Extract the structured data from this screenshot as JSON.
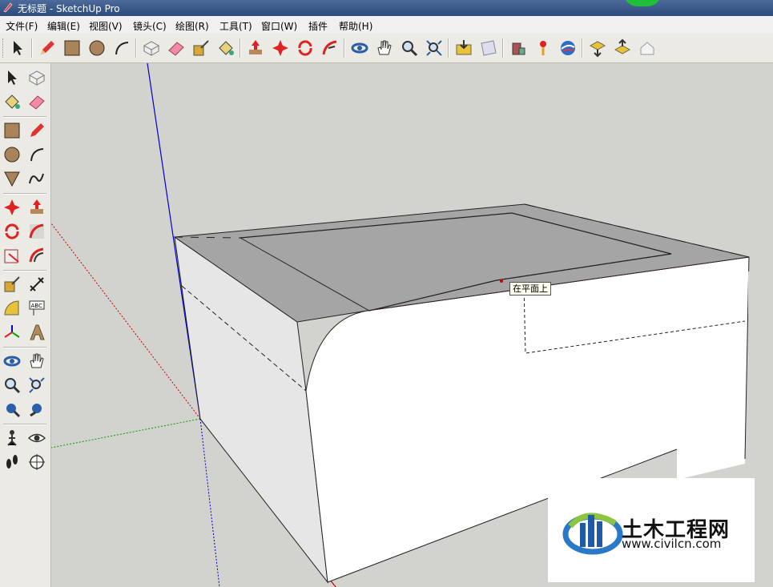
{
  "window": {
    "title": "无标题 - SketchUp Pro"
  },
  "menu": [
    "文件(F)",
    "编辑(E)",
    "视图(V)",
    "镜头(C)",
    "绘图(R)",
    "工具(T)",
    "窗口(W)",
    "插件",
    "帮助(H)"
  ],
  "toolbar_icons": [
    "select-icon",
    "pencil-icon",
    "rectangle-icon",
    "circle-icon",
    "arc-icon",
    "make-component-icon",
    "eraser-icon",
    "tape-measure-icon",
    "paint-bucket-icon",
    "push-pull-icon",
    "move-icon",
    "rotate-icon",
    "follow-me-icon",
    "orbit-icon",
    "pan-icon",
    "zoom-icon",
    "zoom-extents-icon",
    "get-models-icon",
    "share-model-icon",
    "components-icon",
    "place-model-icon",
    "google-earth-icon",
    "get-current-view-icon",
    "toggle-terrain-icon",
    "preview-icon"
  ],
  "left_toolbar_icons": [
    "select-icon",
    "make-component-icon",
    "paint-bucket-icon",
    "eraser-icon",
    "rectangle-icon",
    "line-icon",
    "circle-icon",
    "arc-icon",
    "polygon-icon",
    "freehand-icon",
    "move-icon",
    "push-pull-icon",
    "rotate-icon",
    "follow-me-icon",
    "scale-icon",
    "offset-icon",
    "tape-measure-icon",
    "dimension-icon",
    "protractor-icon",
    "text-icon",
    "axes-icon",
    "3d-text-icon",
    "orbit-icon",
    "pan-icon",
    "zoom-icon",
    "zoom-window-icon",
    "zoom-extents-icon",
    "previous-view-icon",
    "position-camera-icon",
    "look-around-icon",
    "walk-icon",
    "section-plane-icon"
  ],
  "tooltip": "在平面上",
  "colors": {
    "background": "#d2d2cf",
    "axis_red": "#cc0000",
    "axis_green": "#00a000",
    "axis_blue": "#0000cc",
    "top_face": "#a5a5a5",
    "side_face": "#e6e6e6",
    "front_face": "#ffffff"
  },
  "watermark": {
    "text": "土木工程网",
    "url": "www.civilcn.com"
  }
}
